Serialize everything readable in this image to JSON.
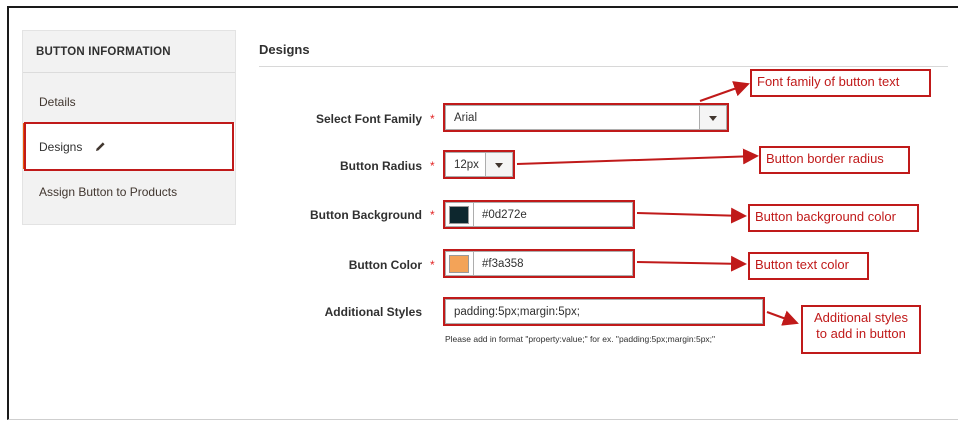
{
  "sidebar": {
    "heading": "BUTTON INFORMATION",
    "items": [
      {
        "label": "Details"
      },
      {
        "label": "Designs"
      },
      {
        "label": "Assign Button to Products"
      }
    ]
  },
  "section": {
    "title": "Designs"
  },
  "form": {
    "font_family": {
      "label": "Select Font Family",
      "required": "*",
      "value": "Arial"
    },
    "button_radius": {
      "label": "Button Radius",
      "required": "*",
      "value": "12px"
    },
    "button_background": {
      "label": "Button Background",
      "required": "*",
      "value": "#0d272e",
      "swatch_color": "#0d272e"
    },
    "button_color": {
      "label": "Button Color",
      "required": "*",
      "value": "#f3a358",
      "swatch_color": "#f3a358"
    },
    "additional_styles": {
      "label": "Additional Styles",
      "value": "padding:5px;margin:5px;",
      "hint": "Please add in format \"property:value;\" for ex. \"padding:5px;margin:5px;\""
    }
  },
  "annotations": {
    "font_family": "Font family of button text",
    "radius": "Button border radius",
    "background": "Button background color",
    "text_color": "Button text color",
    "additional_line1": "Additional styles",
    "additional_line2": "to add in button"
  },
  "colors": {
    "accent": "#eb5202",
    "annotation": "#c01a1a",
    "required": "#e22626"
  }
}
